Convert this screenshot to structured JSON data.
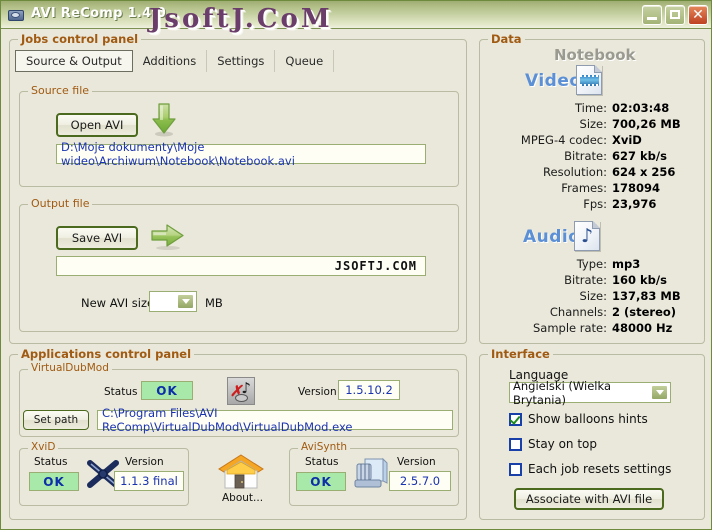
{
  "window": {
    "title": "AVI ReComp  1.4.0",
    "icon": "app-film-icon",
    "watermark": "JsoftJ.CoM",
    "buttons": {
      "minimize": "minimize",
      "maximize": "maximize",
      "close": "close"
    }
  },
  "jobs_panel": {
    "legend": "Jobs control panel",
    "tabs": [
      {
        "label": "Source & Output",
        "active": true
      },
      {
        "label": "Additions",
        "active": false
      },
      {
        "label": "Settings",
        "active": false
      },
      {
        "label": "Queue",
        "active": false
      }
    ]
  },
  "source_file": {
    "legend": "Source file",
    "open_button": "Open AVI",
    "arrow_icon": "arrow-down-icon",
    "path": "D:\\Moje dokumenty\\Moje wideo\\Archiwum\\Notebook\\Notebook.avi"
  },
  "output_file": {
    "legend": "Output file",
    "save_button": "Save AVI",
    "arrow_icon": "arrow-right-icon",
    "path": "JSOFTJ.COM",
    "size_label": "New AVI size =",
    "size_value": "",
    "size_unit": "MB"
  },
  "applications_panel": {
    "legend": "Applications control panel",
    "virtualdubmod": {
      "legend": "VirtualDubMod",
      "status_label": "Status",
      "status_value": "OK",
      "icon": "virtualdubmod-icon",
      "version_label": "Version",
      "version_value": "1.5.10.2",
      "set_path_button": "Set path",
      "path": "C:\\Program Files\\AVI ReComp\\VirtualDubMod\\VirtualDubMod.exe"
    },
    "xvid": {
      "legend": "XviD",
      "status_label": "Status",
      "status_value": "OK",
      "icon": "xvid-icon",
      "version_label": "Version",
      "version_value": "1.1.3 final"
    },
    "about": {
      "label": "About...",
      "icon": "house-icon"
    },
    "avisynth": {
      "legend": "AviSynth",
      "status_label": "Status",
      "status_value": "OK",
      "icon": "avisynth-icon",
      "version_label": "Version",
      "version_value": "2.5.7.0"
    }
  },
  "data_panel": {
    "legend": "Data",
    "file_name": "Notebook",
    "video": {
      "heading": "Video",
      "icon": "video-file-icon",
      "rows": [
        {
          "label": "Time:",
          "value": "02:03:48"
        },
        {
          "label": "Size:",
          "value": "700,26 MB"
        },
        {
          "label": "MPEG-4 codec:",
          "value": "XviD"
        },
        {
          "label": "Bitrate:",
          "value": "627 kb/s"
        },
        {
          "label": "Resolution:",
          "value": "624 x 256"
        },
        {
          "label": "Frames:",
          "value": "178094"
        },
        {
          "label": "Fps:",
          "value": "23,976"
        }
      ]
    },
    "audio": {
      "heading": "Audio",
      "icon": "audio-file-icon",
      "rows": [
        {
          "label": "Type:",
          "value": "mp3"
        },
        {
          "label": "Bitrate:",
          "value": "160 kb/s"
        },
        {
          "label": "Size:",
          "value": "137,83 MB"
        },
        {
          "label": "Channels:",
          "value": "2 (stereo)"
        },
        {
          "label": "Sample rate:",
          "value": "48000 Hz"
        }
      ]
    }
  },
  "interface_panel": {
    "legend": "Interface",
    "language_label": "Language",
    "language_value": "Angielski (Wielka Brytania)",
    "checkboxes": [
      {
        "label": "Show balloons hints",
        "checked": true
      },
      {
        "label": "Stay on top",
        "checked": false
      },
      {
        "label": "Each job resets settings",
        "checked": false
      }
    ],
    "associate_button": "Associate with AVI file"
  },
  "colors": {
    "panel_bg": "#EAE8DA",
    "window_border": "#6E8B3D",
    "legend_orange": "#A05A12",
    "field_text_blue": "#1533a0",
    "status_ok_bg": "#A8E8A8",
    "status_ok_text": "#0c2ea8",
    "heading_blue": "#5B8FD6",
    "title_gradient_start": "#9FAE72",
    "title_gradient_end": "#EFF1DF",
    "close_button": "#BF4122"
  }
}
